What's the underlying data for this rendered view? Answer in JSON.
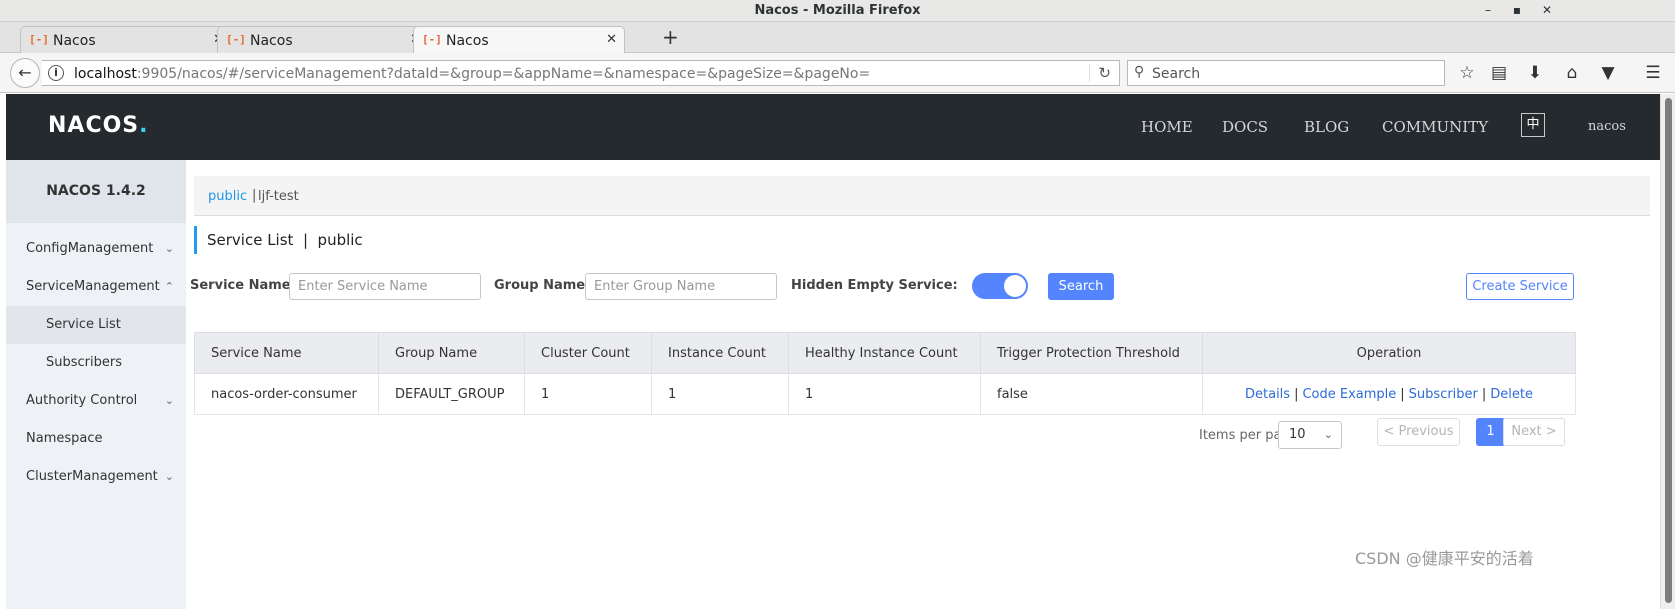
{
  "window": {
    "title": "Nacos - Mozilla Firefox",
    "minimize": "–",
    "maximize": "▪",
    "close": "✕"
  },
  "browser": {
    "tabs": [
      {
        "favicon": "[-]",
        "label": "Nacos"
      },
      {
        "favicon": "[-]",
        "label": "Nacos"
      },
      {
        "favicon": "[-]",
        "label": "Nacos"
      }
    ],
    "tab_close": "✕",
    "new_tab": "+",
    "url_host": "localhost",
    "url_rest": ":9905/nacos/#/serviceManagement?dataId=&group=&appName=&namespace=&pageSize=&pageNo=",
    "search_placeholder": "Search"
  },
  "header": {
    "logo_text": "NACOS",
    "logo_dot": ".",
    "nav": [
      "HOME",
      "DOCS",
      "BLOG",
      "COMMUNITY"
    ],
    "lang": "中",
    "user": "nacos"
  },
  "sidebar": {
    "version": "NACOS 1.4.2",
    "items": [
      {
        "label": "ConfigManagement"
      },
      {
        "label": "ServiceManagement"
      },
      {
        "label": "Service List"
      },
      {
        "label": "Subscribers"
      },
      {
        "label": "Authority Control"
      },
      {
        "label": "Namespace"
      },
      {
        "label": "ClusterManagement"
      }
    ]
  },
  "namespaces": {
    "active": "public",
    "separator": "|",
    "other": "ljf-test"
  },
  "page_title": "Service List  |  public",
  "filters": {
    "service_name_label": "Service Name",
    "service_name_placeholder": "Enter Service Name",
    "group_name_label": "Group Name",
    "group_name_placeholder": "Enter Group Name",
    "hidden_empty_label": "Hidden Empty Service:",
    "search_button": "Search",
    "create_button": "Create Service"
  },
  "table": {
    "columns": [
      "Service Name",
      "Group Name",
      "Cluster Count",
      "Instance Count",
      "Healthy Instance Count",
      "Trigger Protection Threshold",
      "Operation"
    ],
    "rows": [
      {
        "service_name": "nacos-order-consumer",
        "group_name": "DEFAULT_GROUP",
        "cluster_count": "1",
        "instance_count": "1",
        "healthy_count": "1",
        "threshold": "false"
      }
    ],
    "operations": [
      "Details",
      "Code Example",
      "Subscriber",
      "Delete"
    ],
    "op_separator": "|"
  },
  "pagination": {
    "items_per_page_label": "Items per page:",
    "page_size": "10",
    "previous": "< Previous",
    "current": "1",
    "next": "Next >"
  },
  "watermark": "CSDN @健康平安的活着"
}
